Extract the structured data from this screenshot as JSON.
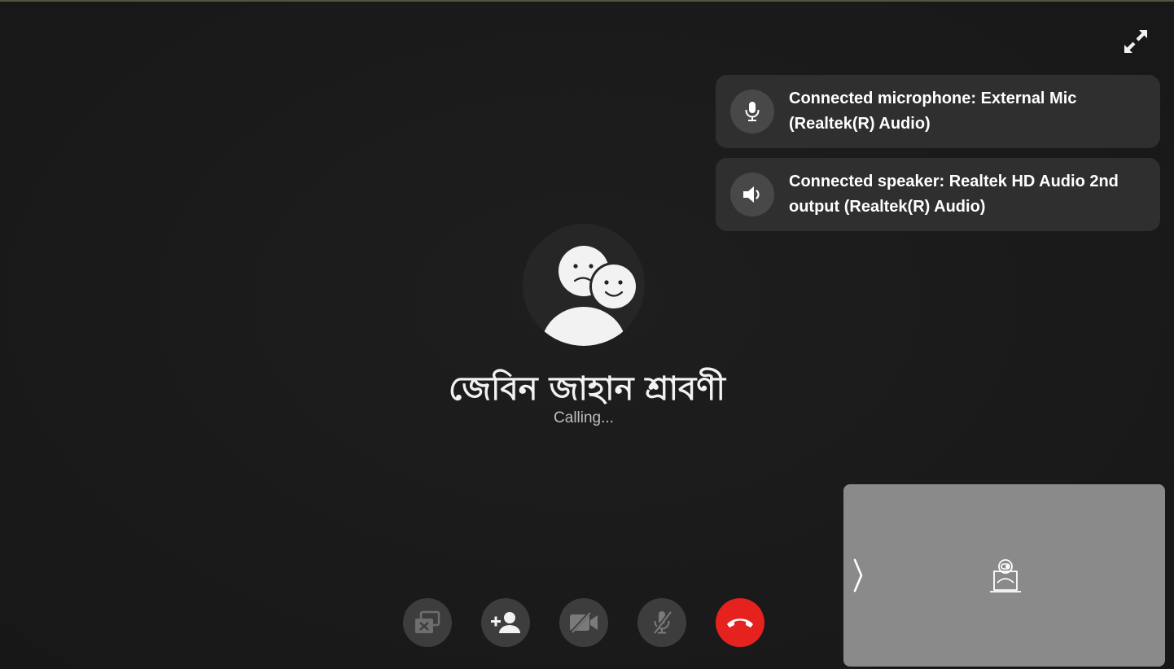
{
  "call": {
    "contact_name": "জেবিন জাহান শ্রাবণী",
    "status": "Calling..."
  },
  "notifications": [
    {
      "icon": "microphone-icon",
      "text": "Connected microphone: External Mic (Realtek(R) Audio)"
    },
    {
      "icon": "speaker-icon",
      "text": "Connected speaker: Realtek HD Audio 2nd output (Realtek(R) Audio)"
    }
  ],
  "controls": [
    {
      "name": "screen-share-off-button",
      "icon": "screen-share-off-icon"
    },
    {
      "name": "add-participant-button",
      "icon": "add-person-icon"
    },
    {
      "name": "video-off-button",
      "icon": "video-off-icon"
    },
    {
      "name": "mute-microphone-button",
      "icon": "microphone-off-icon"
    },
    {
      "name": "end-call-button",
      "icon": "hang-up-icon"
    }
  ],
  "colors": {
    "background": "#1b1b1b",
    "toast_bg": "#2f2f2f",
    "control_bg": "#3d3d3d",
    "end_call": "#e5221e",
    "self_view_bg": "#8a8a8a"
  },
  "self_view": {
    "icon": "camera-off-icon",
    "collapse_icon": "chevron-right-icon"
  }
}
